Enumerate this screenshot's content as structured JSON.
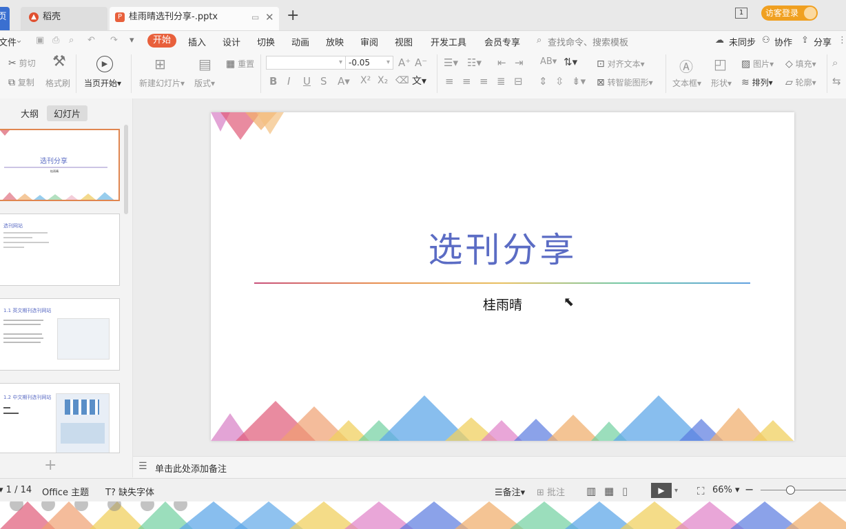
{
  "titlebar": {
    "home_tab": "页",
    "docer_tab": "稻壳",
    "doc_tab": "桂雨晴选刊分享-.pptx",
    "new_tab_symbol": "+",
    "window_badge": "1",
    "login_button": "访客登录"
  },
  "menubar": {
    "file": "文件",
    "items": [
      "开始",
      "插入",
      "设计",
      "切换",
      "动画",
      "放映",
      "审阅",
      "视图",
      "开发工具",
      "会员专享"
    ],
    "search_placeholder": "查找命令、搜索模板",
    "sync": "未同步",
    "collab": "协作",
    "share": "分享"
  },
  "ribbon": {
    "cut": "剪切",
    "copy": "复制",
    "format_painter": "格式刷",
    "play_from_current": "当页开始",
    "new_slide": "新建幻灯片",
    "layout": "版式",
    "reset": "重置",
    "font_size_value": "-0.05",
    "align_text": "对齐文本",
    "smart_art": "转智能图形",
    "textbox": "文本框",
    "shape": "形状",
    "picture": "图片",
    "arrange": "排列",
    "fill": "填充",
    "outline": "轮廓"
  },
  "leftpanel": {
    "outline_tab": "大纲",
    "slides_tab": "幻灯片",
    "thumb1_title": "选刊分享",
    "thumb1_sub": "桂雨晴",
    "thumb2_title": "选刊网站",
    "thumb3_title": "1.1 英文期刊选刊网站",
    "thumb4_title": "1.2 中文期刊选刊网站",
    "add_symbol": "+"
  },
  "slide": {
    "title": "选刊分享",
    "subtitle": "桂雨晴"
  },
  "notes": {
    "placeholder": "单击此处添加备注"
  },
  "statusbar": {
    "page": "1 / 14",
    "theme": "Office 主题",
    "missing_font": "缺失字体",
    "notes_btn": "备注",
    "comment_btn": "批注",
    "zoom": "66%"
  },
  "colors": {
    "accent": "#e8603c",
    "title_blue": "#5b6cc4",
    "home_tab": "#3a6fd0",
    "login": "#f0a020"
  }
}
